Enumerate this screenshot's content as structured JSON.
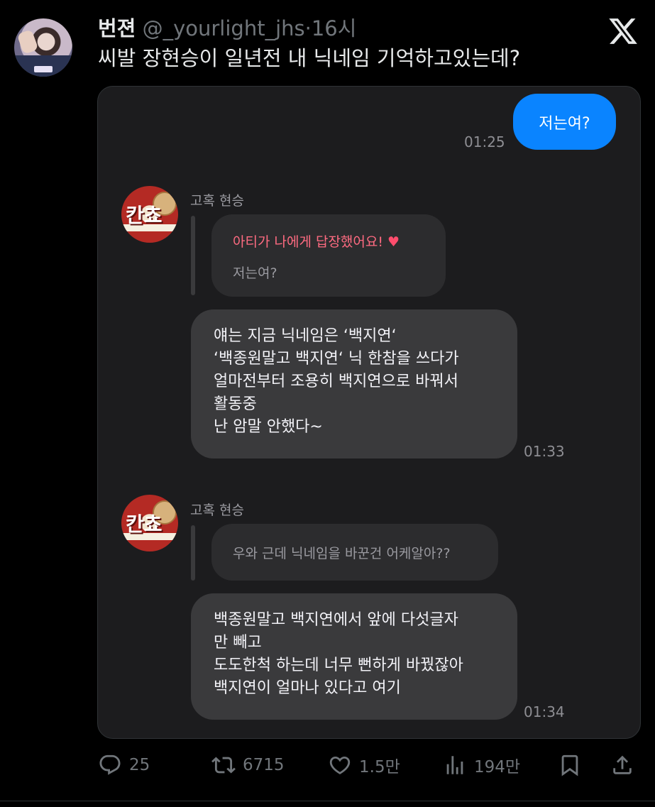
{
  "tweet": {
    "author_name": "번젼",
    "handle": "@_yourlight_jhs",
    "separator": "·",
    "time": "16시",
    "text": "씨발 장현승이 일년전 내 닉네임 기억하고있는데?"
  },
  "chat": {
    "me_message": "저는여?",
    "me_time": "01:25",
    "group1": {
      "sender": "고혹 현승",
      "quote_title": "아티가 나에게 답장했어요!",
      "quote_icon": "heart-icon",
      "quote_text": "저는여?",
      "message_lines": [
        "얘는 지금 닉네임은 ‘백지연‘",
        "‘백종원말고 백지연‘ 닉 한참을 쓰다가",
        "얼마전부터 조용히 백지연으로 바꿔서",
        "활동중",
        "난 암말 안했다~"
      ],
      "time": "01:33"
    },
    "group2": {
      "sender": "고혹 현승",
      "quote_text": "우와 근데 닉네임을 바꾼건 어케알아??",
      "message_lines": [
        "백종원말고 백지연에서 앞에 다섯글자",
        "만 빼고",
        "도도한척 하는데 너무 뻔하게 바꿨잖아",
        "백지연이 얼마나 있다고 여기"
      ],
      "time": "01:34"
    }
  },
  "actions": {
    "replies": "25",
    "reposts": "6715",
    "likes": "1.5만",
    "views": "194만"
  },
  "colors": {
    "background": "#000000",
    "chat_bg": "#1c1c1e",
    "my_bubble": "#0a84ff",
    "their_bubble": "#3a3a3c",
    "highlight": "#ff6b81"
  }
}
